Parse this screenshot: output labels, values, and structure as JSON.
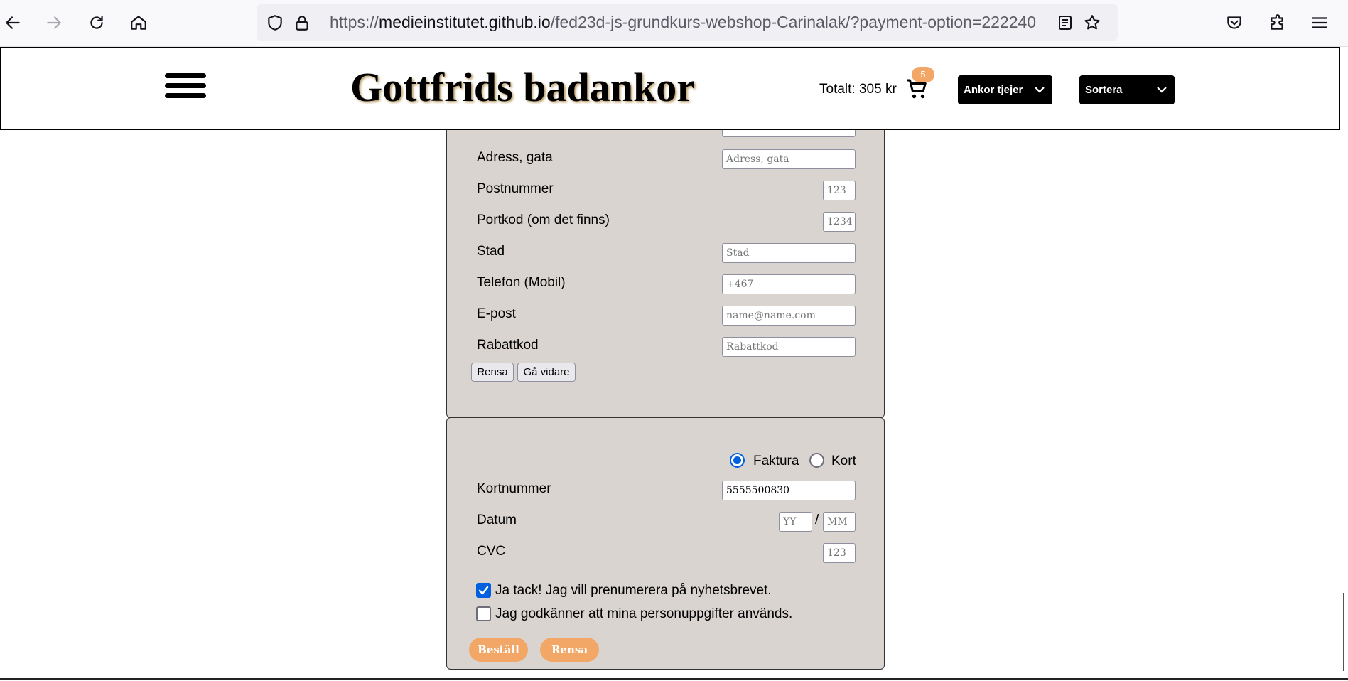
{
  "browser": {
    "url_prefix": "https://",
    "url_host": "medieinstitutet.github.io",
    "url_path": "/fed23d-js-grundkurs-webshop-Carinalak/?payment-option=222240"
  },
  "header": {
    "title": "Gottfrids badankor",
    "total": "Totalt: 305 kr",
    "cart_count": "5",
    "filter_label": "Ankor tjejer",
    "sort_label": "Sortera"
  },
  "customer_form": {
    "fields": {
      "street": {
        "label": "Adress, gata",
        "placeholder": "Adress, gata"
      },
      "postcode": {
        "label": "Postnummer",
        "placeholder": "123"
      },
      "doorcode": {
        "label": "Portkod (om det finns)",
        "placeholder": "1234"
      },
      "city": {
        "label": "Stad",
        "placeholder": "Stad"
      },
      "phone": {
        "label": "Telefon (Mobil)",
        "placeholder": "+467"
      },
      "email": {
        "label": "E-post",
        "placeholder": "name@name.com"
      },
      "discount": {
        "label": "Rabattkod",
        "placeholder": "Rabattkod"
      }
    },
    "clear_label": "Rensa",
    "next_label": "Gå vidare"
  },
  "payment_form": {
    "options": {
      "invoice": "Faktura",
      "card": "Kort",
      "selected": "invoice"
    },
    "card_number": {
      "label": "Kortnummer",
      "value": "5555500830"
    },
    "date": {
      "label": "Datum",
      "year_placeholder": "YY",
      "separator": "/",
      "month_placeholder": "MM"
    },
    "cvc": {
      "label": "CVC",
      "placeholder": "123"
    },
    "newsletter": {
      "label": "Ja tack! Jag vill prenumerera på nyhetsbrevet.",
      "checked": true
    },
    "gdpr": {
      "label": "Jag godkänner att mina personuppgifter används.",
      "checked": false
    },
    "order_label": "Beställ",
    "clear_label": "Rensa"
  },
  "colors": {
    "accent": "#f2a766",
    "panel": "#d9d4d0",
    "dropdown": "#000000",
    "selected": "#0060df"
  }
}
